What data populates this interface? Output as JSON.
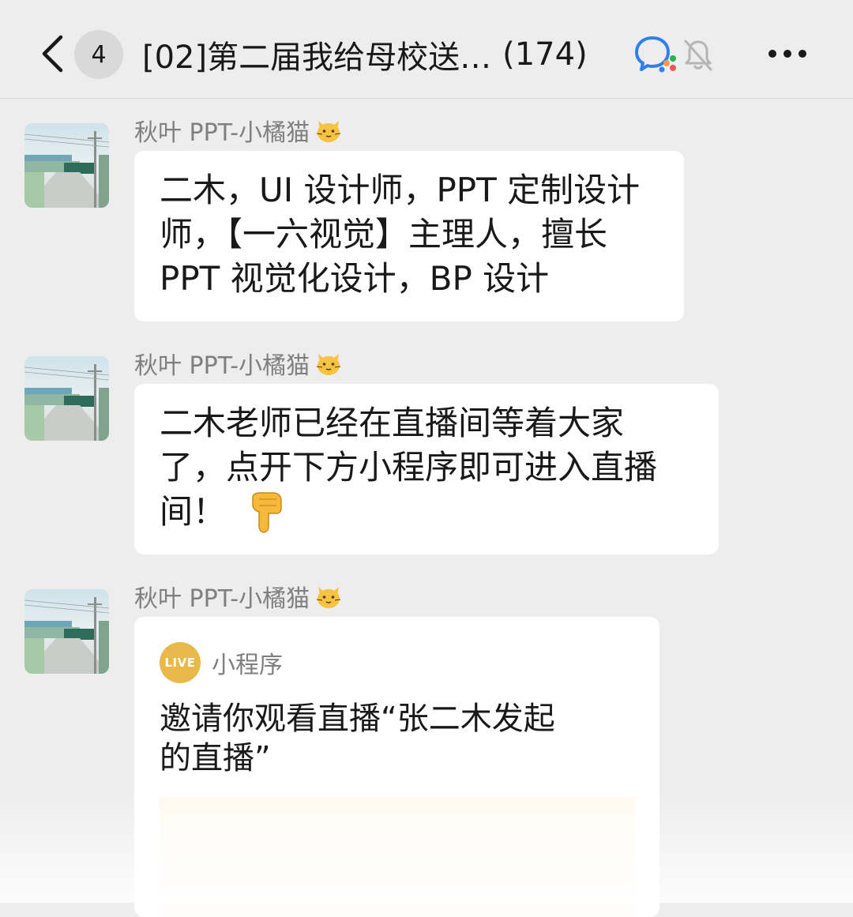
{
  "header": {
    "back_label": "<",
    "unread_count": "4",
    "title": "[02]第二届我给母校送…",
    "member_count": "(174)",
    "wecom_icon": "wecom-chat-icon",
    "mute_icon": "bell-muted-icon",
    "more_icon": "more-dots-icon"
  },
  "messages": [
    {
      "sender": "秋叶 PPT-小橘猫",
      "sender_emoji": "cat-face-emoji",
      "lines": [
        "二木，UI 设计师，PPT 定制设计",
        "师，【一六视觉】主理人，擅长",
        "PPT 视觉化设计，BP 设计"
      ]
    },
    {
      "sender": "秋叶 PPT-小橘猫",
      "sender_emoji": "cat-face-emoji",
      "lines": [
        "二木老师已经在直播间等着大家",
        "了，点开下方小程序即可进入直播",
        "间！"
      ],
      "trailing_emoji": "pointing-down-hand-emoji"
    },
    {
      "sender": "秋叶 PPT-小橘猫",
      "sender_emoji": "cat-face-emoji",
      "card": {
        "badge": "LIVE",
        "source": "小程序",
        "title_lines": [
          "邀请你观看直播“张二木发起",
          "的直播”"
        ]
      }
    }
  ],
  "colors": {
    "background": "#ededed",
    "bubble": "#ffffff",
    "live_badge": "#e9b84a",
    "sender_text": "#7f7f7f"
  }
}
